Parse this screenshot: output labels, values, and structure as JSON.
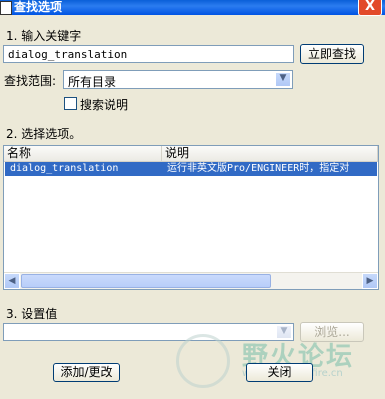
{
  "window": {
    "title": "查找选项",
    "close_glyph": "X"
  },
  "section1": {
    "label": "1.  输入关键字",
    "keyword_value": "dialog_translation",
    "find_button": "立即查找"
  },
  "scope": {
    "label": "查找范围:",
    "value": "所有目录",
    "search_desc_label": "搜索说明"
  },
  "section2": {
    "label": "2.  选择选项。"
  },
  "list": {
    "columns": [
      "名称",
      "说明"
    ],
    "rows": [
      {
        "name": "dialog_translation",
        "desc": "运行非英文版Pro/ENGINEER时，指定对",
        "selected": true
      }
    ]
  },
  "section3": {
    "label": "3.  设置值",
    "value": "",
    "browse_button": "浏览..."
  },
  "buttons": {
    "add_change": "添加/更改",
    "close": "关闭"
  },
  "watermark": {
    "text": "野火论坛",
    "url": "www.proewildfire.cn"
  }
}
